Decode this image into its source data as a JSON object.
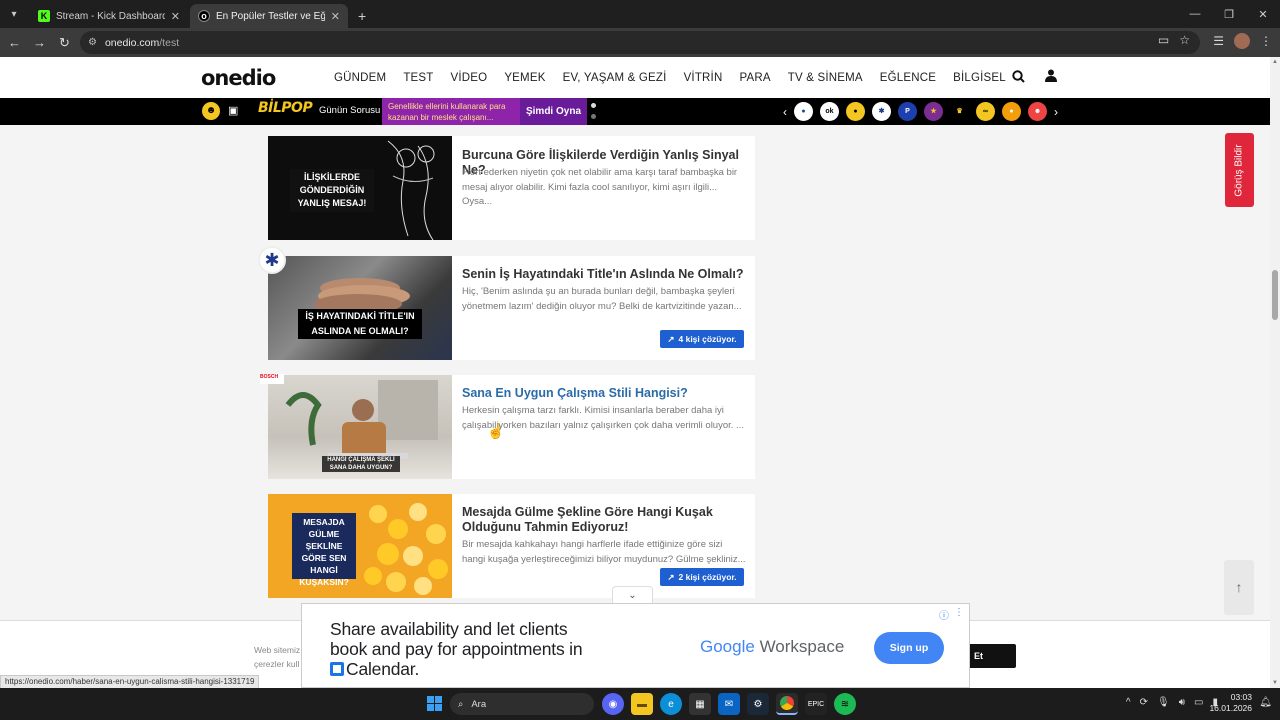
{
  "browser": {
    "tabs": [
      {
        "title": "Stream - Kick Dashboard",
        "icon": "kick-icon",
        "active": false
      },
      {
        "title": "En Popüler Testler ve Eğlenceli Te",
        "icon": "onedio-icon",
        "active": true
      }
    ],
    "url_domain": "onedio.com",
    "url_path": "/test",
    "status_url": "https://onedio.com/haber/sana-en-uygun-calisma-stili-hangisi-1331719"
  },
  "site": {
    "logo": "onedio",
    "nav": [
      "GÜNDEM",
      "TEST",
      "VİDEO",
      "YEMEK",
      "EV, YAŞAM & GEZİ",
      "VİTRİN",
      "PARA",
      "TV & SİNEMA",
      "EĞLENCE",
      "BİLGİSEL"
    ],
    "strip": {
      "bilpop": "BİLPOP",
      "gunun_sorusu": "Günün Sorusu",
      "promo": "Genellikle ellerini kullanarak para kazanan bir meslek çalışanı...",
      "play": "Şimdi Oyna"
    }
  },
  "cards": [
    {
      "title": "Burcuna Göre İlişkilerde Verdiğin Yanlış Sinyal Ne?",
      "desc": "Flört ederken niyetin çok net olabilir ama karşı taraf bambaşka bir mesaj alıyor olabilir. Kimi fazla cool sanılıyor, kimi aşırı ilgili... Oysa...",
      "thumb_caption": "İLİŞKİLERDE GÖNDERDİĞİN YANLIŞ MESAJ!",
      "badge": ""
    },
    {
      "title": "Senin İş Hayatındaki Title'ın Aslında Ne Olmalı?",
      "desc": "Hiç, 'Benim aslında şu an burada bunları değil, bambaşka şeyleri yönetmem lazım' dediğin oluyor mu? Belki de kartvizitinde yazan...",
      "thumb_caption": "İŞ HAYATINDAKİ TİTLE'IN ASLINDA NE OLMALI?",
      "badge": "4 kişi çözüyor."
    },
    {
      "title": "Sana En Uygun Çalışma Stili Hangisi?",
      "desc": "Herkesin çalışma tarzı farklı. Kimisi insanlarla beraber daha iyi çalışabiliyorken bazıları yalnız çalışırken çok daha verimli oluyor. ...",
      "thumb_caption": "HANGİ ÇALIŞMA ŞEKLİ SANA DAHA UYGUN?",
      "sponsor": "BOSCH",
      "badge": ""
    },
    {
      "title": "Mesajda Gülme Şekline Göre Hangi Kuşak Olduğunu Tahmin Ediyoruz!",
      "desc": "Bir mesajda kahkahayı hangi harflerle ifade ettiğinize göre sizi hangi kuşağa yerleştireceğimizi biliyor muydunuz? Gülme şekliniz...",
      "thumb_caption": "MESAJDA GÜLME ŞEKLİNE GÖRE SEN HANGİ KUŞAKSIN?",
      "badge": "2 kişi çözüyor."
    }
  ],
  "feedback": "Görüş Bildir",
  "cookie": {
    "text_line1": "Web sitemiz",
    "text_line2": "çerezler kull",
    "button": "Et"
  },
  "ad": {
    "headline_1": "Share availability and let clients book and pay for appointments in",
    "headline_2": "Calendar.",
    "brand_google": "Google",
    "brand_workspace": "Workspace",
    "cta": "Sign up"
  },
  "taskbar": {
    "search": "Ara",
    "time": "03:03",
    "date": "16.01.2026"
  }
}
